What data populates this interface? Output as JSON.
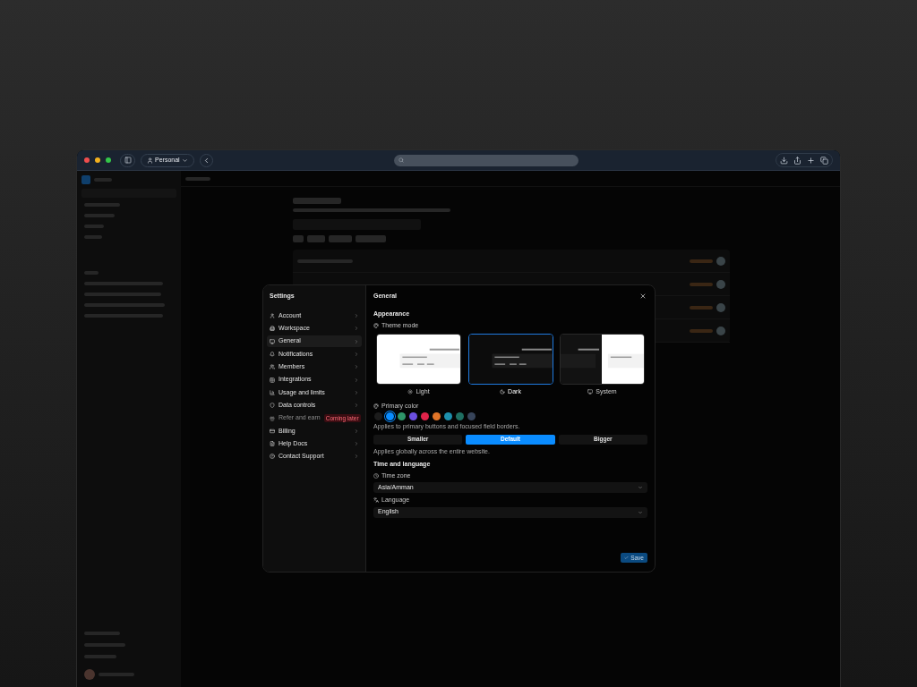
{
  "browser": {
    "profile": "Personal"
  },
  "settings": {
    "title": "Settings",
    "menu": [
      {
        "label": "Account",
        "kind": "user",
        "selected": false,
        "disabled": false
      },
      {
        "label": "Workspace",
        "kind": "building",
        "selected": false,
        "disabled": false
      },
      {
        "label": "General",
        "kind": "monitor",
        "selected": true,
        "disabled": false
      },
      {
        "label": "Notifications",
        "kind": "bell",
        "selected": false,
        "disabled": false
      },
      {
        "label": "Members",
        "kind": "users",
        "selected": false,
        "disabled": false
      },
      {
        "label": "Integrations",
        "kind": "grid",
        "selected": false,
        "disabled": false
      },
      {
        "label": "Usage and limits",
        "kind": "chart",
        "selected": false,
        "disabled": false
      },
      {
        "label": "Data controls",
        "kind": "shield",
        "selected": false,
        "disabled": false
      },
      {
        "label": "Refer and earn",
        "kind": "gift",
        "selected": false,
        "disabled": true,
        "badge": "Coming later"
      },
      {
        "label": "Billing",
        "kind": "card",
        "selected": false,
        "disabled": false
      },
      {
        "label": "Help Docs",
        "kind": "doc",
        "selected": false,
        "disabled": false
      },
      {
        "label": "Contact Support",
        "kind": "help",
        "selected": false,
        "disabled": false
      }
    ],
    "panel": {
      "title": "General",
      "appearance": "Appearance",
      "theme_label": "Theme mode",
      "themes": [
        {
          "label": "Light",
          "kind": "light",
          "selected": false
        },
        {
          "label": "Dark",
          "kind": "dark",
          "selected": true
        },
        {
          "label": "System",
          "kind": "system",
          "selected": false
        }
      ],
      "color_label": "Primary color",
      "colors": [
        {
          "color": "#1c1c1c",
          "selected": false
        },
        {
          "color": "#0a8cff",
          "selected": true
        },
        {
          "color": "#2e9468",
          "selected": false
        },
        {
          "color": "#6b4fe0",
          "selected": false
        },
        {
          "color": "#e0234a",
          "selected": false
        },
        {
          "color": "#e07428",
          "selected": false
        },
        {
          "color": "#1e90ad",
          "selected": false
        },
        {
          "color": "#1f6f62",
          "selected": false
        },
        {
          "color": "#37445a",
          "selected": false
        }
      ],
      "color_hint": "Applies to primary buttons and focused field borders.",
      "sizes": [
        {
          "label": "Smaller",
          "selected": false
        },
        {
          "label": "Default",
          "selected": true
        },
        {
          "label": "Bigger",
          "selected": false
        }
      ],
      "size_hint": "Applies globally across the entire website.",
      "time_title": "Time and language",
      "timezone": {
        "label": "Time zone",
        "value": "Asia/Amman"
      },
      "language": {
        "label": "Language",
        "value": "English"
      },
      "save": "Save"
    }
  }
}
